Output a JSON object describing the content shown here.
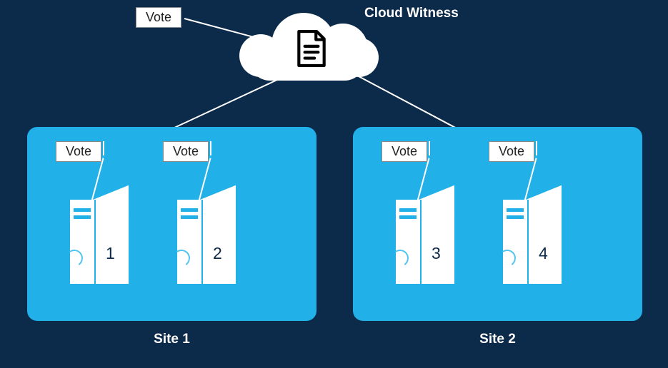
{
  "title": "Cloud Witness",
  "witness": {
    "vote_label": "Vote"
  },
  "sites": [
    {
      "label": "Site 1",
      "servers": [
        {
          "vote_label": "Vote",
          "number": "1"
        },
        {
          "vote_label": "Vote",
          "number": "2"
        }
      ]
    },
    {
      "label": "Site 2",
      "servers": [
        {
          "vote_label": "Vote",
          "number": "3"
        },
        {
          "vote_label": "Vote",
          "number": "4"
        }
      ]
    }
  ]
}
